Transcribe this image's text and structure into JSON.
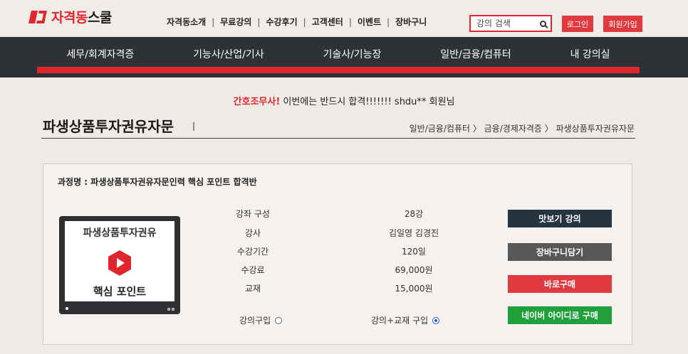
{
  "header": {
    "logo": {
      "accent": "자격동",
      "rest": "스쿨"
    },
    "nav": [
      "자격동소개",
      "무료강의",
      "수강후기",
      "고객센터",
      "이벤트",
      "장바구니"
    ],
    "search_placeholder": "강의 검색",
    "login": "로그인",
    "join": "회원가입"
  },
  "category_nav": [
    "세무/회계자격증",
    "기능사/산업/기사",
    "기술사/기능장",
    "일반/금융/컴퓨터",
    "내 강의실"
  ],
  "notice": {
    "highlight": "간호조무사!",
    "text": "이번에는 반드시 합격!!!!!!! shdu** 회원님"
  },
  "page": {
    "title": "파생상품투자권유자문",
    "breadcrumb": "일반/금융/컴퓨터 〉 금융/경제자격증 〉 파생상품투자권유자문"
  },
  "course": {
    "name": "과정명 : 파생상품투자권유자문인력 핵심 포인트 합격반",
    "thumb_title": "파생상품투자권유",
    "thumb_sub": "핵심 포인트",
    "details": [
      {
        "label": "강좌 구성",
        "value": "28강"
      },
      {
        "label": "강사",
        "value": "김일영 김경진"
      },
      {
        "label": "수강기간",
        "value": "120일"
      },
      {
        "label": "수강료",
        "value": "69,000원"
      },
      {
        "label": "교재",
        "value": "15,000원"
      }
    ],
    "options": [
      {
        "label": "강의구입",
        "selected": false
      },
      {
        "label": "강의+교재 구입",
        "selected": true
      }
    ],
    "buttons": {
      "preview": "맛보기 강의",
      "cart": "장바구니담기",
      "buy": "바로구매",
      "naver": "네이버 아이디로 구매"
    }
  },
  "colors": {
    "brand_red": "#e0262d",
    "nav_dark": "#2e3136",
    "naver_green": "#1fa03c",
    "preview_dark": "#263442",
    "cart_gray": "#585858"
  }
}
